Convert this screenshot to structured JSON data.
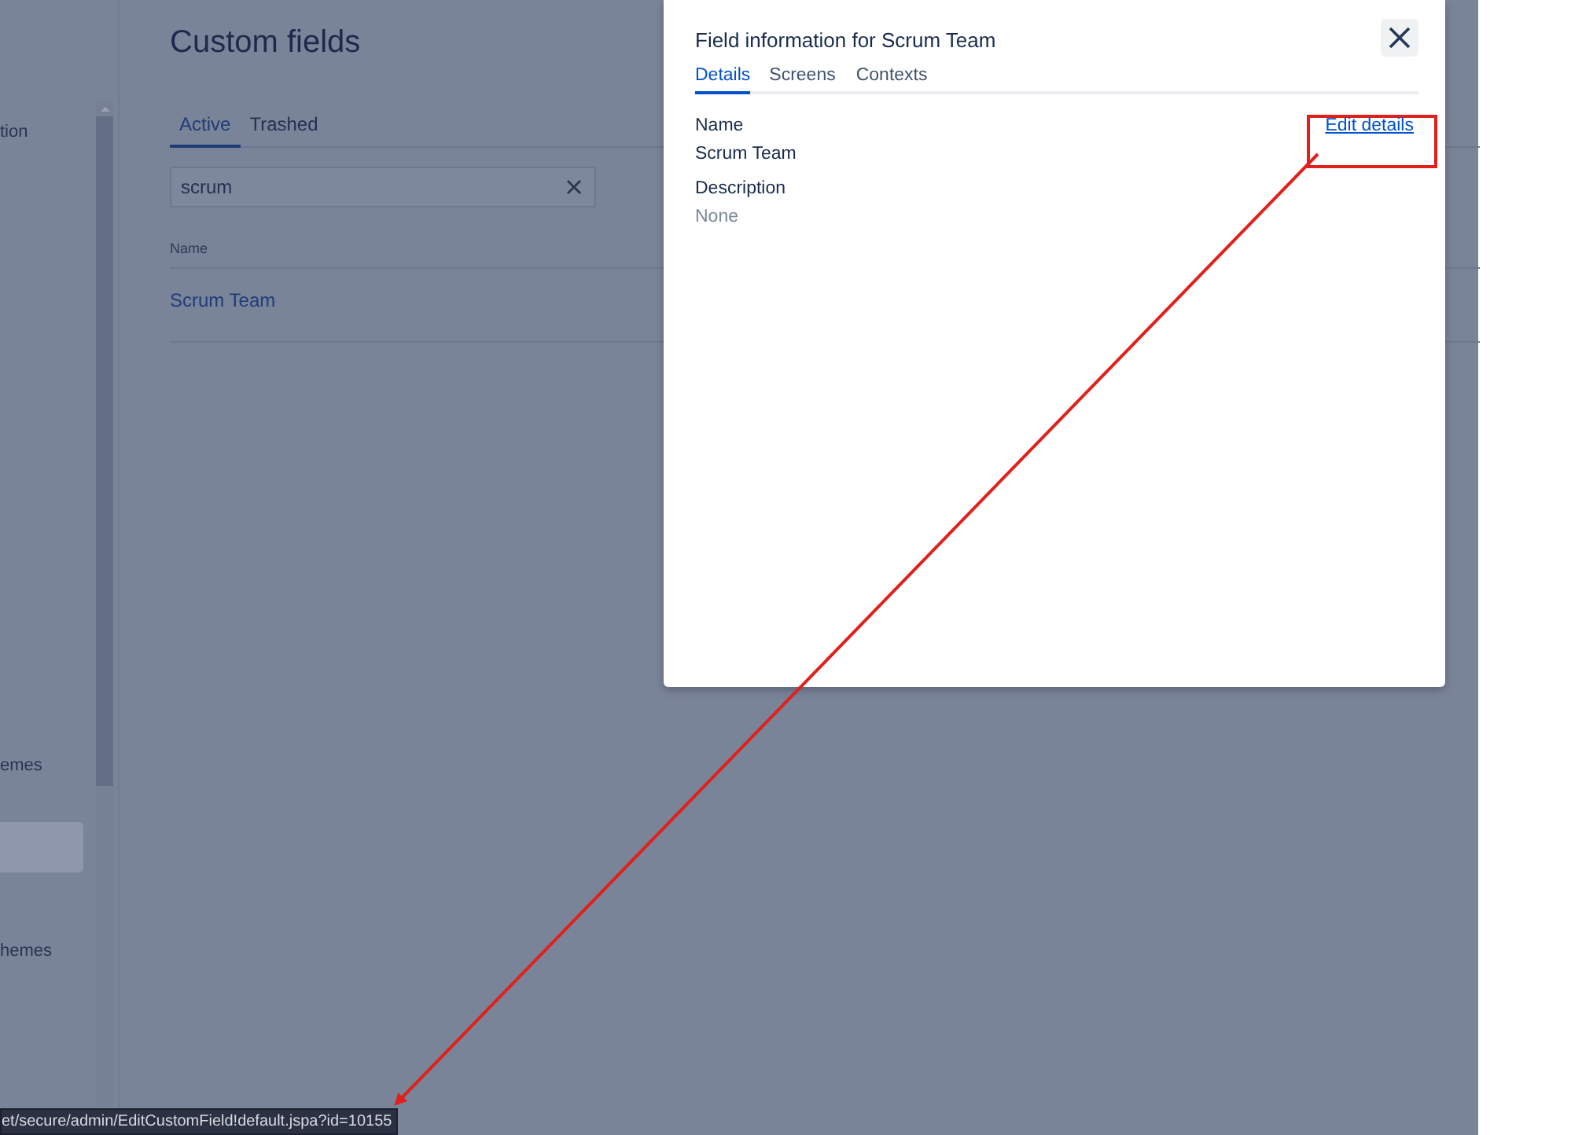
{
  "sidebar": {
    "items": [
      {
        "label": "tion",
        "selected": false
      },
      {
        "label": "emes",
        "selected": false
      },
      {
        "selected": true
      },
      {
        "label": "hemes",
        "selected": false
      }
    ]
  },
  "page": {
    "title": "Custom fields",
    "tabs": [
      {
        "label": "Active",
        "selected": true
      },
      {
        "label": "Trashed",
        "selected": false
      }
    ],
    "search": {
      "value": "scrum"
    },
    "table": {
      "columns": [
        "Name"
      ],
      "rows": [
        [
          "Scrum Team"
        ]
      ]
    }
  },
  "dialog": {
    "title": "Field information for Scrum Team",
    "tabs": [
      {
        "label": "Details",
        "selected": true
      },
      {
        "label": "Screens",
        "selected": false
      },
      {
        "label": "Contexts",
        "selected": false
      }
    ],
    "fields": [
      {
        "label": "Name",
        "value": "Scrum Team",
        "empty": false
      },
      {
        "label": "Description",
        "value": "None",
        "empty": true
      }
    ],
    "edit_link": "Edit details"
  },
  "status_bar": {
    "url": "et/secure/admin/EditCustomField!default.jspa?id=10155"
  }
}
